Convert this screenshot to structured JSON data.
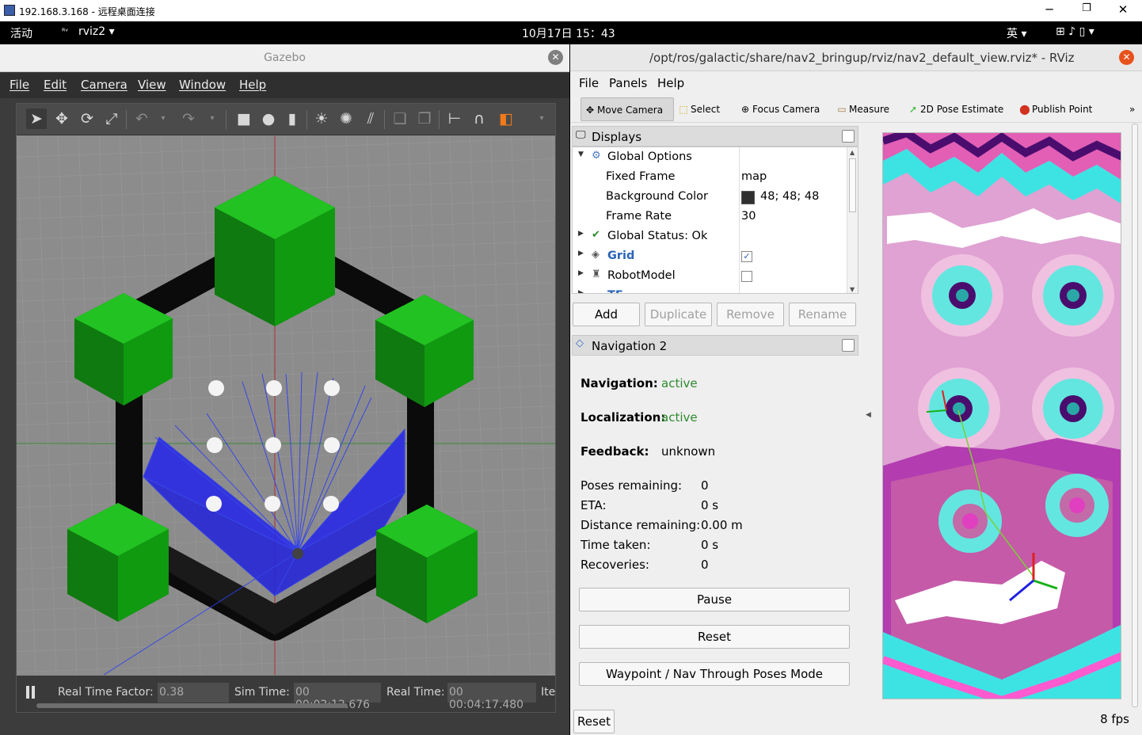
{
  "rdp": {
    "title": "192.168.3.168 - 远程桌面连接",
    "minimize": "─",
    "restore": "❐",
    "close": "✕"
  },
  "gnome": {
    "activities": "活动",
    "app": "rviz2 ▾",
    "clock": "10月17日  15：43",
    "input_method": "英 ▾",
    "status_icons": "⊞  ♪  ▯ ▾"
  },
  "gazebo": {
    "title": "Gazebo",
    "menu": [
      "File",
      "Edit",
      "Camera",
      "View",
      "Window",
      "Help"
    ],
    "toolbar_icons": [
      "select-arrow-icon",
      "translate-icon",
      "rotate-icon",
      "scale-icon",
      "undo-icon",
      "redo-icon",
      "box-shape-icon",
      "sphere-shape-icon",
      "cylinder-shape-icon",
      "point-light-icon",
      "spot-light-icon",
      "directional-light-icon",
      "copy-icon",
      "paste-icon",
      "align-icon",
      "snap-icon",
      "view-angle-icon"
    ],
    "status": {
      "rtf_label": "Real Time Factor:",
      "rtf_value": "0.38",
      "sim_label": "Sim Time:",
      "sim_value": "00 00:02:12.676",
      "real_label": "Real Time:",
      "real_value": "00 00:04:17.480",
      "iter_label": "Ite"
    }
  },
  "rviz": {
    "title": "/opt/ros/galactic/share/nav2_bringup/rviz/nav2_default_view.rviz* - RViz",
    "menu": [
      "File",
      "Panels",
      "Help"
    ],
    "tools": [
      {
        "label": "Move Camera",
        "icon": "move-camera-icon",
        "active": true
      },
      {
        "label": "Select",
        "icon": "select-icon"
      },
      {
        "label": "Focus Camera",
        "icon": "focus-camera-icon"
      },
      {
        "label": "Measure",
        "icon": "measure-icon"
      },
      {
        "label": "2D Pose Estimate",
        "icon": "pose-estimate-icon"
      },
      {
        "label": "Publish Point",
        "icon": "publish-point-icon"
      }
    ],
    "tools_more": "»",
    "displays": {
      "header": "Displays",
      "rows": [
        {
          "name": "Global Options",
          "expanded": true
        },
        {
          "name": "Fixed Frame",
          "value": "map"
        },
        {
          "name": "Background Color",
          "value": "48; 48; 48",
          "swatch": "#303030"
        },
        {
          "name": "Frame Rate",
          "value": "30"
        },
        {
          "name": "Global Status: Ok"
        },
        {
          "name": "Grid",
          "checked": true
        },
        {
          "name": "RobotModel",
          "checked": false
        },
        {
          "name": "TF"
        }
      ],
      "buttons": {
        "add": "Add",
        "duplicate": "Duplicate",
        "remove": "Remove",
        "rename": "Rename"
      }
    },
    "navigation": {
      "header": "Navigation 2",
      "navigation_label": "Navigation:",
      "navigation_value": "active",
      "localization_label": "Localization:",
      "localization_value": "active",
      "feedback_label": "Feedback:",
      "feedback_value": "unknown",
      "poses_label": "Poses remaining:",
      "poses_value": "0",
      "eta_label": "ETA:",
      "eta_value": "0 s",
      "distance_label": "Distance remaining:",
      "distance_value": "0.00 m",
      "time_label": "Time taken:",
      "time_value": "0 s",
      "recoveries_label": "Recoveries:",
      "recoveries_value": "0",
      "pause_button": "Pause",
      "reset_button": "Reset",
      "waypoint_button": "Waypoint / Nav Through Poses Mode"
    },
    "bottom": {
      "reset": "Reset",
      "fps": "8 fps"
    }
  }
}
